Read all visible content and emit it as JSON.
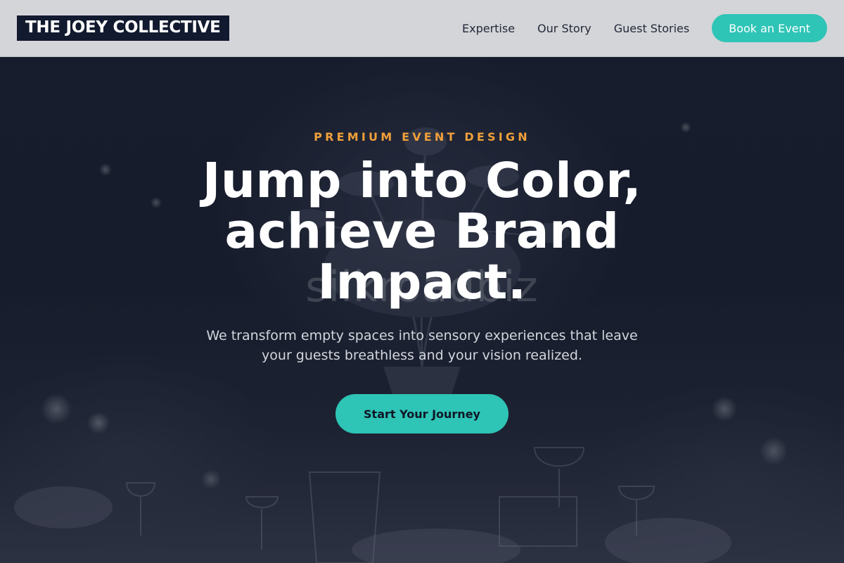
{
  "header": {
    "logo_text": "THE JOEY COLLECTIVE",
    "nav": [
      {
        "label": "Expertise"
      },
      {
        "label": "Our Story"
      },
      {
        "label": "Guest Stories"
      }
    ],
    "book_button_label": "Book an Event"
  },
  "hero": {
    "eyebrow": "PREMIUM EVENT DESIGN",
    "headline": "Jump into Color, achieve Brand Impact.",
    "subtitle": "We transform empty spaces into sensory experiences that leave your guests breathless and your vision realized.",
    "cta_label": "Start Your Journey",
    "watermark_text": "silkroadbiz"
  },
  "colors": {
    "accent": "#2ec4b6",
    "eyebrow": "#f0a03a",
    "header_bg": "#d4d5d8",
    "logo_bg": "#111a2e",
    "hero_bg": "#141a2b"
  }
}
